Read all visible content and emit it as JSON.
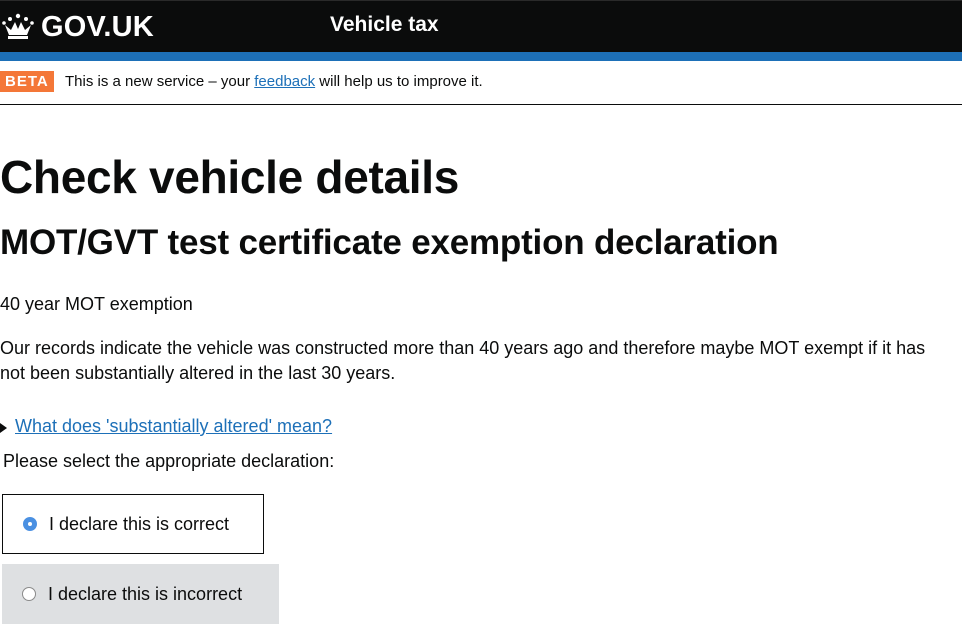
{
  "header": {
    "logo_text": "GOV.UK",
    "logo_icon": "crown-icon",
    "service_name": "Vehicle tax"
  },
  "phase_banner": {
    "tag": "BETA",
    "text_before": "This is a new service – your ",
    "link_text": "feedback",
    "text_after": " will help us to improve it."
  },
  "main": {
    "title": "Check vehicle details",
    "subtitle": "MOT/GVT test certificate exemption declaration",
    "exemption_type": "40 year MOT exemption",
    "description": "Our records indicate the vehicle was constructed more than 40 years ago and therefore maybe MOT exempt if it has not been substantially altered in the last 30 years.",
    "details_summary": "What does 'substantially altered' mean?",
    "select_prompt": "Please select the appropriate declaration:",
    "options": [
      {
        "label": "I declare this is correct",
        "selected": true
      },
      {
        "label": "I declare this is incorrect",
        "selected": false
      }
    ]
  },
  "colors": {
    "header_bg": "#0b0c0c",
    "stripe": "#1d70b8",
    "beta_tag": "#f47738",
    "link": "#1d70b8",
    "unselected_option_bg": "#dee0e2"
  }
}
